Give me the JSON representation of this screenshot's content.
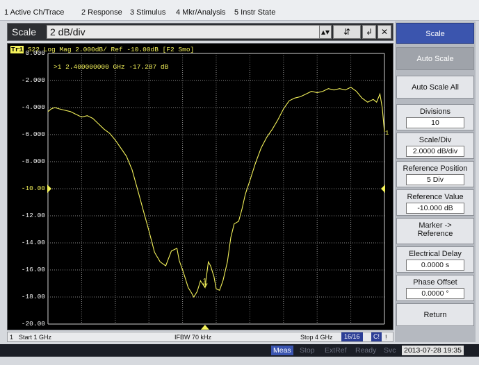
{
  "menu": [
    "1 Active Ch/Trace",
    "2 Response",
    "3 Stimulus",
    "4 Mkr/Analysis",
    "5 Instr State"
  ],
  "entry": {
    "label": "Scale",
    "value": "2 dB/div",
    "enter_glyph": "↲",
    "close_glyph": "✕"
  },
  "trace": {
    "tag": "Tr1",
    "header": "S22 Log Mag 2.000dB/ Ref -10.00dB [F2 Smo]",
    "marker_readout": ">1  2.400000000 GHz -17.287 dB",
    "marker_label": "1",
    "end_label": "1",
    "color": "#f4f25a"
  },
  "y_ticks": [
    "0.000",
    "-2.000",
    "-4.000",
    "-6.000",
    "-8.000",
    "-10.00",
    "-12.00",
    "-14.00",
    "-16.00",
    "-18.00",
    "-20.00"
  ],
  "chart_data": {
    "type": "line",
    "title": "",
    "xlabel": "",
    "ylabel": "",
    "xlim": [
      1.0,
      4.0
    ],
    "ylim": [
      -20,
      0
    ],
    "reference_level": -10,
    "grid": true,
    "series": [
      {
        "x": [
          1.0,
          1.03,
          1.06,
          1.1,
          1.15,
          1.2,
          1.25,
          1.3,
          1.35,
          1.4,
          1.45,
          1.5,
          1.55,
          1.6,
          1.65,
          1.7,
          1.75,
          1.8,
          1.85,
          1.9,
          1.95,
          2.0,
          2.05,
          2.1,
          2.15,
          2.17,
          2.2,
          2.22,
          2.25,
          2.28,
          2.3,
          2.33,
          2.36,
          2.4,
          2.43,
          2.45,
          2.48,
          2.5,
          2.53,
          2.56,
          2.6,
          2.63,
          2.66,
          2.7,
          2.73,
          2.76,
          2.8,
          2.85,
          2.9,
          2.95,
          3.0,
          3.05,
          3.1,
          3.15,
          3.2,
          3.25,
          3.3,
          3.35,
          3.4,
          3.45,
          3.5,
          3.55,
          3.6,
          3.65,
          3.7,
          3.75,
          3.8,
          3.85,
          3.9,
          3.93,
          3.96,
          3.98,
          4.0
        ],
        "y": [
          -4.3,
          -4.1,
          -4.0,
          -4.1,
          -4.2,
          -4.3,
          -4.5,
          -4.7,
          -4.6,
          -4.8,
          -5.2,
          -5.6,
          -5.9,
          -6.4,
          -7.0,
          -7.6,
          -8.6,
          -10.1,
          -11.6,
          -13.1,
          -14.7,
          -15.4,
          -15.7,
          -14.6,
          -14.4,
          -15.3,
          -16.0,
          -16.5,
          -17.3,
          -17.7,
          -18.0,
          -17.6,
          -16.8,
          -17.3,
          -15.4,
          -15.7,
          -16.5,
          -17.4,
          -17.5,
          -16.8,
          -15.4,
          -13.6,
          -12.6,
          -12.4,
          -11.5,
          -10.4,
          -9.4,
          -8.1,
          -7.0,
          -6.2,
          -5.6,
          -4.9,
          -4.1,
          -3.5,
          -3.3,
          -3.2,
          -3.0,
          -2.8,
          -2.9,
          -2.8,
          -2.6,
          -2.7,
          -2.6,
          -2.7,
          -2.5,
          -2.8,
          -3.3,
          -3.6,
          -3.4,
          -3.6,
          -3.0,
          -4.0,
          -5.8
        ]
      }
    ],
    "marker": {
      "label": "1",
      "x": 2.4,
      "y": -17.287
    }
  },
  "status": {
    "channel": "1",
    "start": "Start 1 GHz",
    "ifbw": "IFBW 70 kHz",
    "stop": "Stop 4 GHz",
    "points": "16/16",
    "correction": "C!",
    "flag": "!"
  },
  "bottom": {
    "meas": "Meas",
    "stop": "Stop",
    "extref": "ExtRef",
    "ready": "Ready",
    "svc": "Svc",
    "datetime": "2013-07-28 19:35"
  },
  "softkeys": {
    "title": "Scale",
    "auto_scale": "Auto Scale",
    "auto_scale_all": "Auto Scale All",
    "divisions_label": "Divisions",
    "divisions_value": "10",
    "scale_div_label": "Scale/Div",
    "scale_div_value": "2.0000 dB/div",
    "ref_pos_label": "Reference Position",
    "ref_pos_value": "5 Div",
    "ref_value_label": "Reference Value",
    "ref_value_value": "-10.000 dB",
    "marker_ref_line1": "Marker ->",
    "marker_ref_line2": "Reference",
    "elec_delay_label": "Electrical Delay",
    "elec_delay_value": "0.0000 s",
    "phase_offset_label": "Phase Offset",
    "phase_offset_value": "0.0000 °",
    "return": "Return"
  }
}
